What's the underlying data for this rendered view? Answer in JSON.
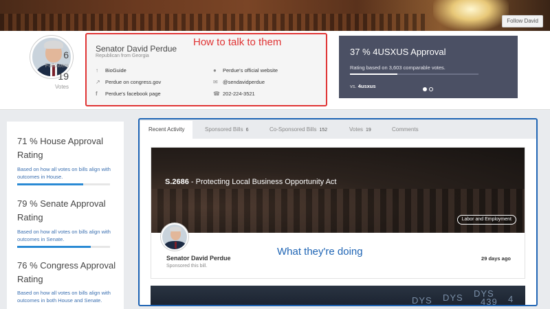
{
  "follow_button": "Follow David",
  "stats": {
    "followers_count": "6",
    "followers_label": "Followers",
    "votes_count": "19",
    "votes_label": "Votes"
  },
  "profile": {
    "name": "Senator David Perdue",
    "subtitle": "Republican from Georgia",
    "links": {
      "bioguide": "BioGuide",
      "website": "Perdue's official website",
      "congress": "Perdue on congress.gov",
      "twitter": "@sendavidperdue",
      "facebook": "Perdue's facebook page",
      "phone": "202-224-3521"
    }
  },
  "annotations": {
    "contact": "How to talk to them",
    "activity": "What they're doing"
  },
  "approval": {
    "title": "37 % 4USXUS Approval",
    "description": "Rating based on 3,603 comparable votes.",
    "progress": 0.37,
    "vs_prefix": "vs.",
    "vs_name": "4usxus"
  },
  "ratings": [
    {
      "title": "71 % House Approval Rating",
      "description": "Based on how all votes on bills align with outcomes in House.",
      "progress": 0.71
    },
    {
      "title": "79 % Senate Approval Rating",
      "description": "Based on how all votes on bills align with outcomes in Senate.",
      "progress": 0.79
    },
    {
      "title": "76 % Congress Approval Rating",
      "description": "Based on how all votes on bills align with outcomes in both House and Senate.",
      "progress": 0.76
    }
  ],
  "tabs": [
    {
      "label": "Recent Activity",
      "count": ""
    },
    {
      "label": "Sponsored Bills",
      "count": "6"
    },
    {
      "label": "Co-Sponsored Bills",
      "count": "152"
    },
    {
      "label": "Votes",
      "count": "19"
    },
    {
      "label": "Comments",
      "count": ""
    }
  ],
  "activity": {
    "bill_number": "S.2686",
    "bill_title": " - Protecting Local Business Opportunity Act",
    "tag": "Labor and Employment",
    "name": "Senator David Perdue",
    "action": "Sponsored this bill.",
    "time": "29 days ago"
  },
  "ticker_text": [
    "DYS",
    "DYS",
    "DYS",
    "439",
    "4"
  ],
  "colors": {
    "highlight_red": "#e03333",
    "highlight_blue": "#1e64b4",
    "approval_bg": "#4b5064",
    "rating_bar": "#2a8ad4",
    "link_blue": "#3a6fb0"
  }
}
